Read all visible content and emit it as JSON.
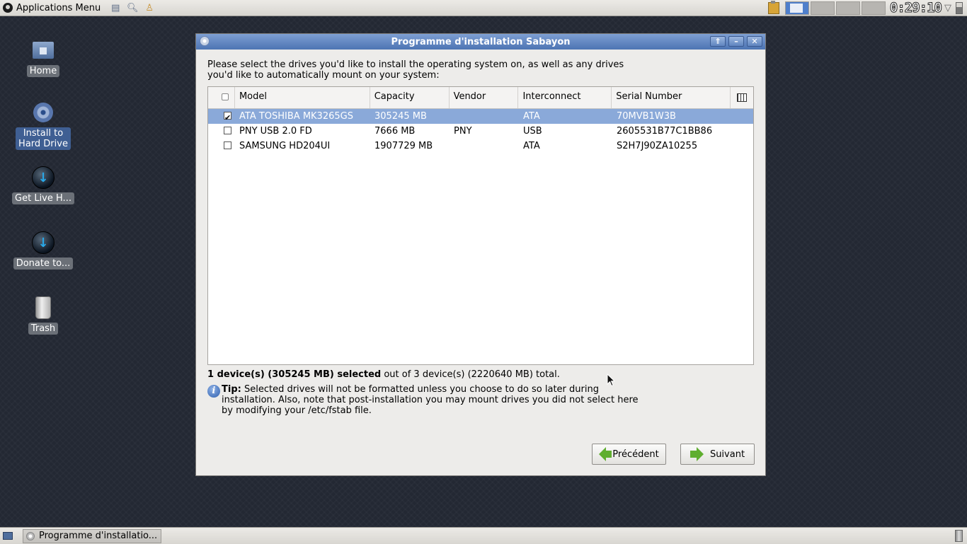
{
  "top_panel": {
    "apps_menu_label": "Applications Menu",
    "clock": "0:29:10"
  },
  "desktop": {
    "icons": [
      {
        "label": "Home"
      },
      {
        "label": "Install to Hard Drive",
        "label_line1": "Install to",
        "label_line2": "Hard Drive"
      },
      {
        "label": "Get Live H..."
      },
      {
        "label": "Donate to..."
      },
      {
        "label": "Trash"
      }
    ]
  },
  "window": {
    "title": "Programme d'installation Sabayon",
    "prompt": "Please select the drives you'd like to install the operating system on, as well as any drives you'd like to automatically mount on your system:",
    "columns": {
      "model": "Model",
      "capacity": "Capacity",
      "vendor": "Vendor",
      "interconnect": "Interconnect",
      "serial": "Serial Number"
    },
    "rows": [
      {
        "checked": true,
        "model": "ATA TOSHIBA MK3265GS",
        "capacity": "305245 MB",
        "vendor": "",
        "interconnect": "ATA",
        "serial": "70MVB1W3B"
      },
      {
        "checked": false,
        "model": "PNY USB 2.0 FD",
        "capacity": "7666 MB",
        "vendor": "PNY",
        "interconnect": "USB",
        "serial": "2605531B77C1BB86"
      },
      {
        "checked": false,
        "model": "SAMSUNG HD204UI",
        "capacity": "1907729 MB",
        "vendor": "",
        "interconnect": "ATA",
        "serial": "S2H7J90ZA10255"
      }
    ],
    "summary_bold": "1 device(s) (305245 MB) selected",
    "summary_rest": " out of 3 device(s) (2220640 MB) total.",
    "tip_label": "Tip:",
    "tip_text": " Selected drives will not be formatted unless you choose to do so later during installation.  Also, note that post-installation you may mount drives you did not select here by modifying your /etc/fstab file.",
    "back_label": "Précédent",
    "next_label": "Suivant"
  },
  "taskbar": {
    "task_label": "Programme d'installatio..."
  },
  "colors": {
    "titlebar": "#5f84bf",
    "selection": "#8aa9d9",
    "desktop_bg": "#232833"
  }
}
